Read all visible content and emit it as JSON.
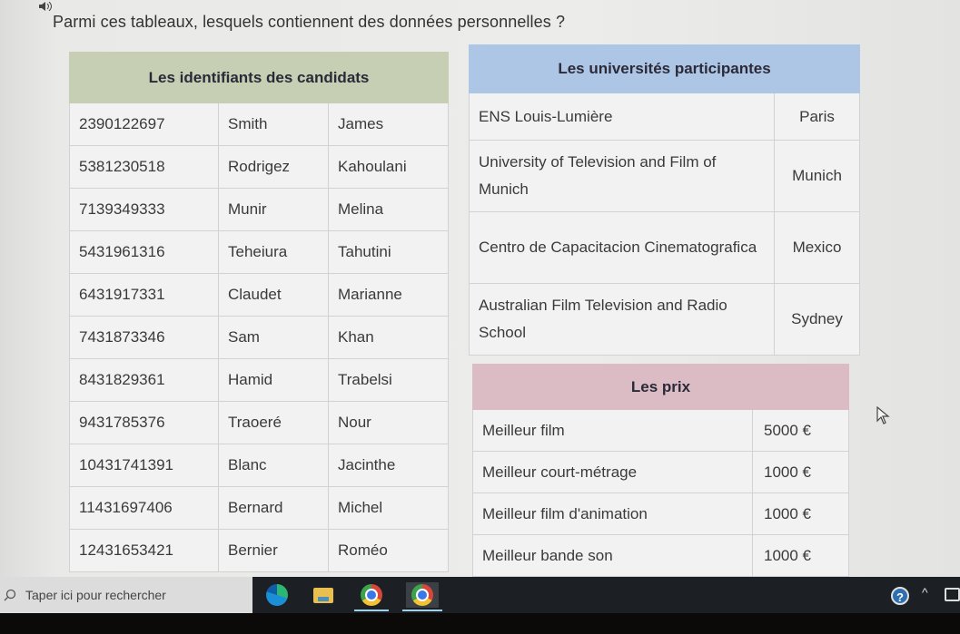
{
  "question": "Parmi ces tableaux, lesquels contiennent des données personnelles ?",
  "icons": {
    "speaker": "speaker-icon",
    "cursor": "mouse-pointer-icon"
  },
  "candidates": {
    "title": "Les identifiants des candidats",
    "header_color": "#c6cfb3",
    "rows": [
      {
        "id": "2390122697",
        "last": "Smith",
        "first": "James"
      },
      {
        "id": "5381230518",
        "last": "Rodrigez",
        "first": "Kahoulani"
      },
      {
        "id": "7139349333",
        "last": "Munir",
        "first": "Melina"
      },
      {
        "id": "5431961316",
        "last": "Teheiura",
        "first": "Tahutini"
      },
      {
        "id": "6431917331",
        "last": "Claudet",
        "first": "Marianne"
      },
      {
        "id": "7431873346",
        "last": "Sam",
        "first": "Khan"
      },
      {
        "id": "8431829361",
        "last": "Hamid",
        "first": "Trabelsi"
      },
      {
        "id": "9431785376",
        "last": "Traoeré",
        "first": "Nour"
      },
      {
        "id": "10431741391",
        "last": "Blanc",
        "first": "Jacinthe"
      },
      {
        "id": "11431697406",
        "last": "Bernard",
        "first": "Michel"
      },
      {
        "id": "12431653421",
        "last": "Bernier",
        "first": "Roméo"
      }
    ]
  },
  "universities": {
    "title": "Les universités participantes",
    "header_color": "#aec6e6",
    "rows": [
      {
        "name": "ENS Louis-Lumière",
        "city": "Paris"
      },
      {
        "name": "University of Television and Film of Munich",
        "city": "Munich"
      },
      {
        "name": "Centro de Capacitacion Cinematografica",
        "city": "Mexico"
      },
      {
        "name": "Australian Film Television and Radio School",
        "city": "Sydney"
      }
    ]
  },
  "prizes": {
    "title": "Les prix",
    "header_color": "#dcbcc4",
    "rows": [
      {
        "label": "Meilleur film",
        "amount": "5000 €"
      },
      {
        "label": "Meilleur court-métrage",
        "amount": "1000 €"
      },
      {
        "label": "Meilleur film d'animation",
        "amount": "1000 €"
      },
      {
        "label": "Meilleur bande son",
        "amount": "1000 €"
      }
    ]
  },
  "taskbar": {
    "search_placeholder": "Taper ici pour rechercher",
    "apps": [
      {
        "name": "Microsoft Edge",
        "icon": "edge-icon"
      },
      {
        "name": "File Explorer",
        "icon": "folder-icon"
      },
      {
        "name": "Google Chrome",
        "icon": "chrome-icon",
        "active": true
      },
      {
        "name": "Google Chrome (profile)",
        "icon": "chrome-icon",
        "active": true,
        "highlighted": true
      }
    ],
    "tray": {
      "help_glyph": "?",
      "chevron_glyph": "^"
    }
  }
}
